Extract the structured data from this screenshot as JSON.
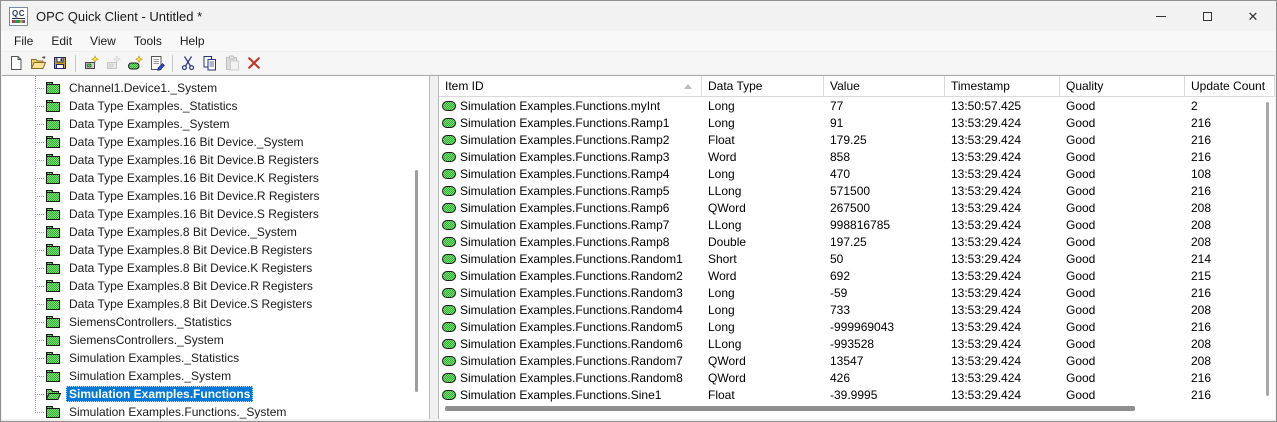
{
  "window": {
    "title": "OPC Quick Client - Untitled *",
    "app_icon_text": "QC"
  },
  "menu": {
    "items": [
      {
        "label": "File"
      },
      {
        "label": "Edit"
      },
      {
        "label": "View"
      },
      {
        "label": "Tools"
      },
      {
        "label": "Help"
      }
    ]
  },
  "toolbar": {
    "buttons": [
      {
        "name": "new-document",
        "enabled": true
      },
      {
        "name": "open-file",
        "enabled": true
      },
      {
        "name": "save-file",
        "enabled": true
      },
      {
        "separator": true
      },
      {
        "name": "new-server-connection",
        "enabled": true
      },
      {
        "name": "new-group",
        "enabled": false
      },
      {
        "name": "new-item",
        "enabled": true
      },
      {
        "name": "properties",
        "enabled": true
      },
      {
        "separator": true
      },
      {
        "name": "cut",
        "enabled": true
      },
      {
        "name": "copy",
        "enabled": true
      },
      {
        "name": "paste",
        "enabled": false
      },
      {
        "name": "delete",
        "enabled": true
      }
    ]
  },
  "tree": {
    "items": [
      {
        "label": "Channel1.Device1._System",
        "selected": false
      },
      {
        "label": "Data Type Examples._Statistics",
        "selected": false
      },
      {
        "label": "Data Type Examples._System",
        "selected": false
      },
      {
        "label": "Data Type Examples.16 Bit Device._System",
        "selected": false
      },
      {
        "label": "Data Type Examples.16 Bit Device.B Registers",
        "selected": false
      },
      {
        "label": "Data Type Examples.16 Bit Device.K Registers",
        "selected": false
      },
      {
        "label": "Data Type Examples.16 Bit Device.R Registers",
        "selected": false
      },
      {
        "label": "Data Type Examples.16 Bit Device.S Registers",
        "selected": false
      },
      {
        "label": "Data Type Examples.8 Bit Device._System",
        "selected": false
      },
      {
        "label": "Data Type Examples.8 Bit Device.B Registers",
        "selected": false
      },
      {
        "label": "Data Type Examples.8 Bit Device.K Registers",
        "selected": false
      },
      {
        "label": "Data Type Examples.8 Bit Device.R Registers",
        "selected": false
      },
      {
        "label": "Data Type Examples.8 Bit Device.S Registers",
        "selected": false
      },
      {
        "label": "SiemensControllers._Statistics",
        "selected": false
      },
      {
        "label": "SiemensControllers._System",
        "selected": false
      },
      {
        "label": "Simulation Examples._Statistics",
        "selected": false
      },
      {
        "label": "Simulation Examples._System",
        "selected": false
      },
      {
        "label": "Simulation Examples.Functions",
        "selected": true
      },
      {
        "label": "Simulation Examples.Functions._System",
        "selected": false
      }
    ]
  },
  "table": {
    "columns": [
      {
        "label": "Item ID",
        "sort": "asc"
      },
      {
        "label": "Data Type"
      },
      {
        "label": "Value"
      },
      {
        "label": "Timestamp"
      },
      {
        "label": "Quality"
      },
      {
        "label": "Update Count"
      }
    ],
    "rows": [
      [
        "Simulation Examples.Functions.myInt",
        "Long",
        "77",
        "13:50:57.425",
        "Good",
        "2"
      ],
      [
        "Simulation Examples.Functions.Ramp1",
        "Long",
        "91",
        "13:53:29.424",
        "Good",
        "216"
      ],
      [
        "Simulation Examples.Functions.Ramp2",
        "Float",
        "179.25",
        "13:53:29.424",
        "Good",
        "216"
      ],
      [
        "Simulation Examples.Functions.Ramp3",
        "Word",
        "858",
        "13:53:29.424",
        "Good",
        "216"
      ],
      [
        "Simulation Examples.Functions.Ramp4",
        "Long",
        "470",
        "13:53:29.424",
        "Good",
        "108"
      ],
      [
        "Simulation Examples.Functions.Ramp5",
        "LLong",
        "571500",
        "13:53:29.424",
        "Good",
        "216"
      ],
      [
        "Simulation Examples.Functions.Ramp6",
        "QWord",
        "267500",
        "13:53:29.424",
        "Good",
        "208"
      ],
      [
        "Simulation Examples.Functions.Ramp7",
        "LLong",
        "998816785",
        "13:53:29.424",
        "Good",
        "208"
      ],
      [
        "Simulation Examples.Functions.Ramp8",
        "Double",
        "197.25",
        "13:53:29.424",
        "Good",
        "208"
      ],
      [
        "Simulation Examples.Functions.Random1",
        "Short",
        "50",
        "13:53:29.424",
        "Good",
        "214"
      ],
      [
        "Simulation Examples.Functions.Random2",
        "Word",
        "692",
        "13:53:29.424",
        "Good",
        "215"
      ],
      [
        "Simulation Examples.Functions.Random3",
        "Long",
        "-59",
        "13:53:29.424",
        "Good",
        "216"
      ],
      [
        "Simulation Examples.Functions.Random4",
        "Long",
        "733",
        "13:53:29.424",
        "Good",
        "208"
      ],
      [
        "Simulation Examples.Functions.Random5",
        "Long",
        "-999969043",
        "13:53:29.424",
        "Good",
        "216"
      ],
      [
        "Simulation Examples.Functions.Random6",
        "LLong",
        "-993528",
        "13:53:29.424",
        "Good",
        "208"
      ],
      [
        "Simulation Examples.Functions.Random7",
        "QWord",
        "13547",
        "13:53:29.424",
        "Good",
        "208"
      ],
      [
        "Simulation Examples.Functions.Random8",
        "QWord",
        "426",
        "13:53:29.424",
        "Good",
        "216"
      ],
      [
        "Simulation Examples.Functions.Sine1",
        "Float",
        "-39.9995",
        "13:53:29.424",
        "Good",
        "216"
      ]
    ]
  },
  "colors": {
    "selection_blue": "#0078d7",
    "folder_green_light": "#7de07d",
    "folder_green_dark": "#2fae2f",
    "delete_red": "#c0392b",
    "toolbar_blue": "#26337f"
  }
}
